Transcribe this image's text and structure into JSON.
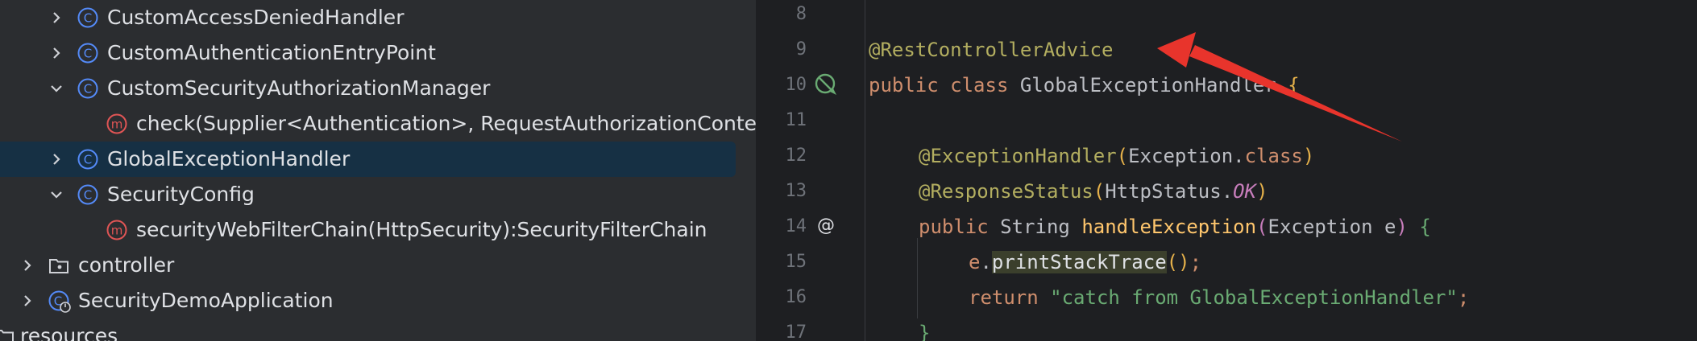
{
  "project_tree": {
    "rows": [
      {
        "label": "CustomAccessDeniedHandler",
        "icon": "class-icon",
        "expanded": false
      },
      {
        "label": "CustomAuthenticationEntryPoint",
        "icon": "class-icon",
        "expanded": false
      },
      {
        "label": "CustomSecurityAuthorizationManager",
        "icon": "class-icon",
        "expanded": true
      },
      {
        "label": "check(Supplier<Authentication>, RequestAuthorizationContext",
        "icon": "method-icon"
      },
      {
        "label": "GlobalExceptionHandler",
        "icon": "class-icon",
        "expanded": false,
        "selected": true
      },
      {
        "label": "SecurityConfig",
        "icon": "class-icon",
        "expanded": true
      },
      {
        "label": "securityWebFilterChain(HttpSecurity):SecurityFilterChain",
        "icon": "method-icon"
      },
      {
        "label": "controller",
        "icon": "folder-icon",
        "expanded": false
      },
      {
        "label": "SecurityDemoApplication",
        "icon": "spring-boot-class-icon",
        "expanded": false
      },
      {
        "label": "resources",
        "icon": "folder-icon"
      }
    ]
  },
  "editor": {
    "line_numbers": [
      "8",
      "9",
      "10",
      "11",
      "12",
      "13",
      "14",
      "15",
      "16",
      "17"
    ],
    "lines": {
      "l9_annotation": "@RestControllerAdvice",
      "l10_public": "public",
      "l10_class": "class",
      "l10_name": "GlobalExceptionHandler",
      "l10_brace": "{",
      "l12_annotation": "@ExceptionHandler",
      "l12_open": "(",
      "l12_type": "Exception",
      "l12_dot": ".",
      "l12_class": "class",
      "l12_close": ")",
      "l13_annotation": "@ResponseStatus",
      "l13_open": "(",
      "l13_type": "HttpStatus",
      "l13_dot": ".",
      "l13_const": "OK",
      "l13_close": ")",
      "l14_public": "public",
      "l14_type": "String",
      "l14_name": "handleException",
      "l14_open": "(",
      "l14_ptype": "Exception",
      "l14_param": "e",
      "l14_close": ")",
      "l14_brace": "{",
      "l15_var": "e",
      "l15_dot": ".",
      "l15_call": "printStackTrace",
      "l15_parens": "()",
      "l15_semi": ";",
      "l16_return": "return",
      "l16_string": "\"catch from GlobalExceptionHandler\"",
      "l16_semi": ";",
      "l17_brace": "}"
    },
    "gutter_icons": {
      "line10": "no-implementations-icon",
      "line14": "at-annotation-icon"
    }
  },
  "colors": {
    "tree_bg": "#2b2d30",
    "editor_bg": "#1e1f22",
    "selection": "#163044",
    "annotation": "#b3ae60",
    "keyword": "#cf8e6d",
    "string": "#6aab73",
    "arrow": "#e8342c"
  }
}
